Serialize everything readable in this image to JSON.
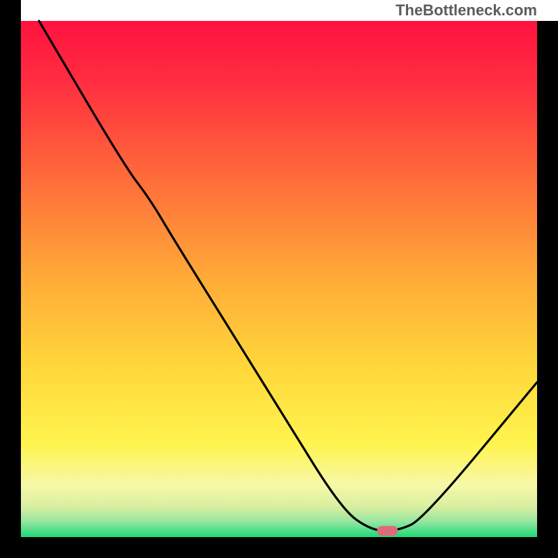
{
  "watermark": "TheBottleneck.com",
  "chart_data": {
    "type": "line",
    "x_range": [
      0,
      100
    ],
    "y_range": [
      0,
      100
    ],
    "title": "",
    "xlabel": "",
    "ylabel": "",
    "curve": [
      {
        "x": 3.5,
        "y": 100
      },
      {
        "x": 20,
        "y": 72
      },
      {
        "x": 25,
        "y": 65.5
      },
      {
        "x": 30,
        "y": 57
      },
      {
        "x": 50,
        "y": 25
      },
      {
        "x": 62,
        "y": 5.5
      },
      {
        "x": 68,
        "y": 1.2
      },
      {
        "x": 73,
        "y": 1.2
      },
      {
        "x": 78,
        "y": 3.5
      },
      {
        "x": 100,
        "y": 30
      }
    ],
    "marker": {
      "x": 71,
      "y": 1.2,
      "color": "#e2697a"
    },
    "background_gradient": {
      "top": "#ff1744",
      "mid_upper": "#ff6f3c",
      "mid": "#ffc13b",
      "mid_lower": "#fff176",
      "bottom_band_1": "#f0f4c3",
      "bottom_band_2": "#c5e1a5",
      "bottom": "#00e676"
    },
    "frame_color": "#000000",
    "curve_color": "#000000"
  }
}
